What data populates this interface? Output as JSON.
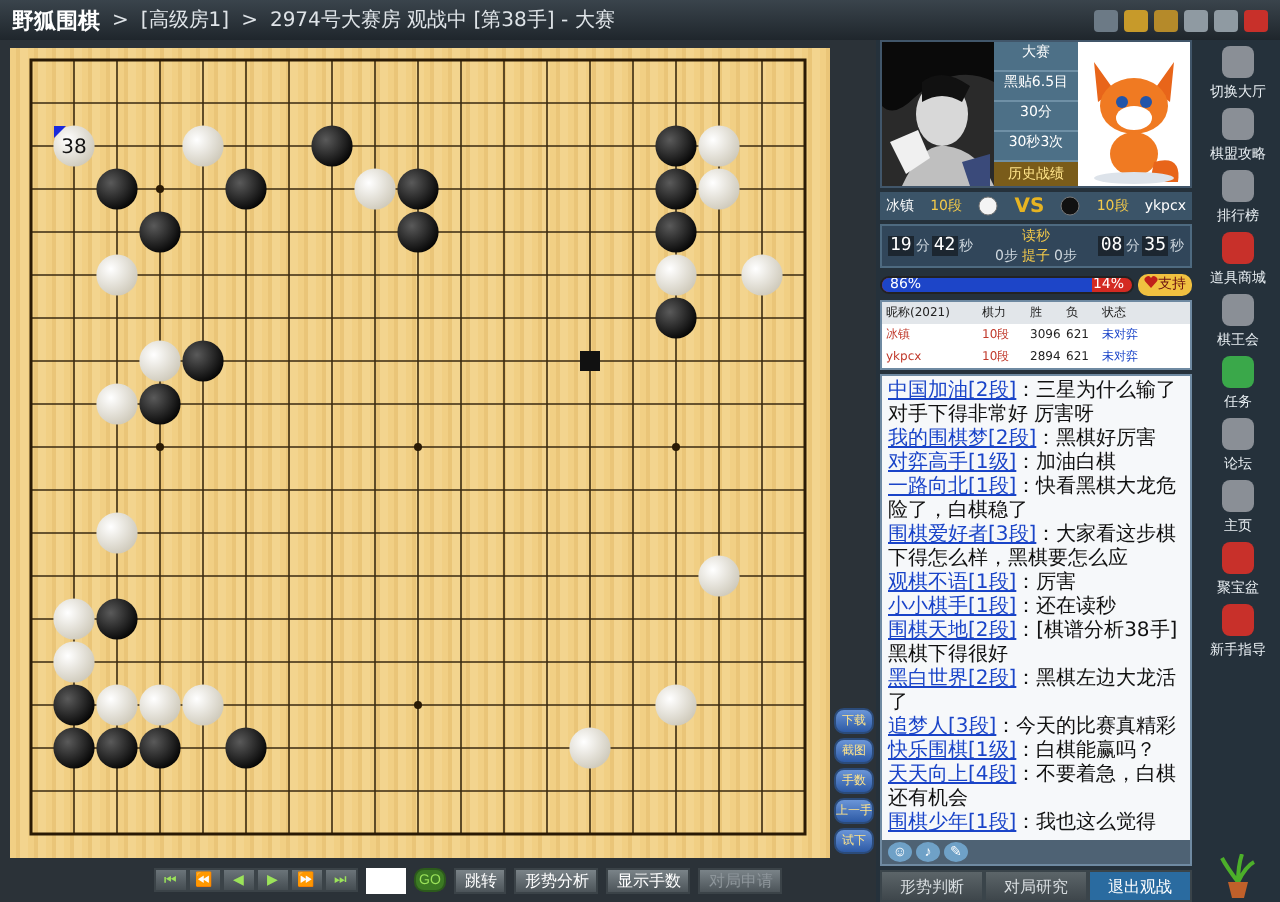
{
  "window": {
    "app_name": "野狐围棋",
    "breadcrumb": [
      {
        "separator": ">",
        "text": "[高级房1]"
      },
      {
        "separator": ">",
        "text": "2974号大赛房 观战中 [第38手] - 大赛"
      }
    ]
  },
  "board": {
    "rows": [
      {
        "points": [
          {
            "kind": "empty"
          },
          {
            "kind": "empty"
          },
          {
            "kind": "empty"
          },
          {
            "kind": "empty"
          },
          {
            "kind": "empty"
          },
          {
            "kind": "empty"
          },
          {
            "kind": "empty"
          },
          {
            "kind": "empty"
          },
          {
            "kind": "empty"
          },
          {
            "kind": "empty"
          },
          {
            "kind": "empty"
          },
          {
            "kind": "empty"
          },
          {
            "kind": "empty"
          },
          {
            "kind": "empty"
          },
          {
            "kind": "empty"
          },
          {
            "kind": "empty"
          },
          {
            "kind": "empty"
          },
          {
            "kind": "empty"
          },
          {
            "kind": "empty"
          }
        ]
      },
      {
        "points": [
          {
            "kind": "empty"
          },
          {
            "kind": "empty"
          },
          {
            "kind": "empty"
          },
          {
            "kind": "empty"
          },
          {
            "kind": "empty"
          },
          {
            "kind": "empty"
          },
          {
            "kind": "empty"
          },
          {
            "kind": "empty"
          },
          {
            "kind": "empty"
          },
          {
            "kind": "empty"
          },
          {
            "kind": "empty"
          },
          {
            "kind": "empty"
          },
          {
            "kind": "empty"
          },
          {
            "kind": "empty"
          },
          {
            "kind": "empty"
          },
          {
            "kind": "empty"
          },
          {
            "kind": "empty"
          },
          {
            "kind": "empty"
          },
          {
            "kind": "empty"
          }
        ]
      },
      {
        "points": [
          {
            "kind": "empty"
          },
          {
            "kind": "white",
            "label": "38",
            "last": true
          },
          {
            "kind": "empty"
          },
          {
            "kind": "empty"
          },
          {
            "kind": "white"
          },
          {
            "kind": "empty"
          },
          {
            "kind": "empty"
          },
          {
            "kind": "black"
          },
          {
            "kind": "empty"
          },
          {
            "kind": "empty"
          },
          {
            "kind": "empty"
          },
          {
            "kind": "empty"
          },
          {
            "kind": "empty"
          },
          {
            "kind": "empty"
          },
          {
            "kind": "empty"
          },
          {
            "kind": "black"
          },
          {
            "kind": "white"
          },
          {
            "kind": "empty"
          },
          {
            "kind": "empty"
          }
        ]
      },
      {
        "points": [
          {
            "kind": "empty"
          },
          {
            "kind": "empty"
          },
          {
            "kind": "black"
          },
          {
            "kind": "empty"
          },
          {
            "kind": "empty"
          },
          {
            "kind": "black"
          },
          {
            "kind": "empty"
          },
          {
            "kind": "empty"
          },
          {
            "kind": "white"
          },
          {
            "kind": "black"
          },
          {
            "kind": "empty"
          },
          {
            "kind": "empty"
          },
          {
            "kind": "empty"
          },
          {
            "kind": "empty"
          },
          {
            "kind": "empty"
          },
          {
            "kind": "black"
          },
          {
            "kind": "white"
          },
          {
            "kind": "empty"
          },
          {
            "kind": "empty"
          }
        ]
      },
      {
        "points": [
          {
            "kind": "empty"
          },
          {
            "kind": "empty"
          },
          {
            "kind": "empty"
          },
          {
            "kind": "black"
          },
          {
            "kind": "empty"
          },
          {
            "kind": "empty"
          },
          {
            "kind": "empty"
          },
          {
            "kind": "empty"
          },
          {
            "kind": "empty"
          },
          {
            "kind": "black"
          },
          {
            "kind": "empty"
          },
          {
            "kind": "empty"
          },
          {
            "kind": "empty"
          },
          {
            "kind": "empty"
          },
          {
            "kind": "empty"
          },
          {
            "kind": "black"
          },
          {
            "kind": "empty"
          },
          {
            "kind": "empty"
          },
          {
            "kind": "empty"
          }
        ]
      },
      {
        "points": [
          {
            "kind": "empty"
          },
          {
            "kind": "empty"
          },
          {
            "kind": "white"
          },
          {
            "kind": "empty"
          },
          {
            "kind": "empty"
          },
          {
            "kind": "empty"
          },
          {
            "kind": "empty"
          },
          {
            "kind": "empty"
          },
          {
            "kind": "empty"
          },
          {
            "kind": "empty"
          },
          {
            "kind": "empty"
          },
          {
            "kind": "empty"
          },
          {
            "kind": "empty"
          },
          {
            "kind": "empty"
          },
          {
            "kind": "empty"
          },
          {
            "kind": "white"
          },
          {
            "kind": "empty"
          },
          {
            "kind": "white"
          },
          {
            "kind": "empty"
          }
        ]
      },
      {
        "points": [
          {
            "kind": "empty"
          },
          {
            "kind": "empty"
          },
          {
            "kind": "empty"
          },
          {
            "kind": "empty"
          },
          {
            "kind": "empty"
          },
          {
            "kind": "empty"
          },
          {
            "kind": "empty"
          },
          {
            "kind": "empty"
          },
          {
            "kind": "empty"
          },
          {
            "kind": "empty"
          },
          {
            "kind": "empty"
          },
          {
            "kind": "empty"
          },
          {
            "kind": "empty"
          },
          {
            "kind": "empty"
          },
          {
            "kind": "empty"
          },
          {
            "kind": "black"
          },
          {
            "kind": "empty"
          },
          {
            "kind": "empty"
          },
          {
            "kind": "empty"
          }
        ]
      },
      {
        "points": [
          {
            "kind": "empty"
          },
          {
            "kind": "empty"
          },
          {
            "kind": "empty"
          },
          {
            "kind": "white"
          },
          {
            "kind": "black"
          },
          {
            "kind": "empty"
          },
          {
            "kind": "empty"
          },
          {
            "kind": "empty"
          },
          {
            "kind": "empty"
          },
          {
            "kind": "empty"
          },
          {
            "kind": "empty"
          },
          {
            "kind": "empty"
          },
          {
            "kind": "empty"
          },
          {
            "kind": "square"
          },
          {
            "kind": "empty"
          },
          {
            "kind": "empty"
          },
          {
            "kind": "empty"
          },
          {
            "kind": "empty"
          },
          {
            "kind": "empty"
          }
        ]
      },
      {
        "points": [
          {
            "kind": "empty"
          },
          {
            "kind": "empty"
          },
          {
            "kind": "white"
          },
          {
            "kind": "black"
          },
          {
            "kind": "empty"
          },
          {
            "kind": "empty"
          },
          {
            "kind": "empty"
          },
          {
            "kind": "empty"
          },
          {
            "kind": "empty"
          },
          {
            "kind": "empty"
          },
          {
            "kind": "empty"
          },
          {
            "kind": "empty"
          },
          {
            "kind": "empty"
          },
          {
            "kind": "empty"
          },
          {
            "kind": "empty"
          },
          {
            "kind": "empty"
          },
          {
            "kind": "empty"
          },
          {
            "kind": "empty"
          },
          {
            "kind": "empty"
          }
        ]
      },
      {
        "points": [
          {
            "kind": "empty"
          },
          {
            "kind": "empty"
          },
          {
            "kind": "empty"
          },
          {
            "kind": "empty"
          },
          {
            "kind": "empty"
          },
          {
            "kind": "empty"
          },
          {
            "kind": "empty"
          },
          {
            "kind": "empty"
          },
          {
            "kind": "empty"
          },
          {
            "kind": "empty"
          },
          {
            "kind": "empty"
          },
          {
            "kind": "empty"
          },
          {
            "kind": "empty"
          },
          {
            "kind": "empty"
          },
          {
            "kind": "empty"
          },
          {
            "kind": "empty"
          },
          {
            "kind": "empty"
          },
          {
            "kind": "empty"
          },
          {
            "kind": "empty"
          }
        ]
      },
      {
        "points": [
          {
            "kind": "empty"
          },
          {
            "kind": "empty"
          },
          {
            "kind": "empty"
          },
          {
            "kind": "empty"
          },
          {
            "kind": "empty"
          },
          {
            "kind": "empty"
          },
          {
            "kind": "empty"
          },
          {
            "kind": "empty"
          },
          {
            "kind": "empty"
          },
          {
            "kind": "empty"
          },
          {
            "kind": "empty"
          },
          {
            "kind": "empty"
          },
          {
            "kind": "empty"
          },
          {
            "kind": "empty"
          },
          {
            "kind": "empty"
          },
          {
            "kind": "empty"
          },
          {
            "kind": "empty"
          },
          {
            "kind": "empty"
          },
          {
            "kind": "empty"
          }
        ]
      },
      {
        "points": [
          {
            "kind": "empty"
          },
          {
            "kind": "empty"
          },
          {
            "kind": "white"
          },
          {
            "kind": "empty"
          },
          {
            "kind": "empty"
          },
          {
            "kind": "empty"
          },
          {
            "kind": "empty"
          },
          {
            "kind": "empty"
          },
          {
            "kind": "empty"
          },
          {
            "kind": "empty"
          },
          {
            "kind": "empty"
          },
          {
            "kind": "empty"
          },
          {
            "kind": "empty"
          },
          {
            "kind": "empty"
          },
          {
            "kind": "empty"
          },
          {
            "kind": "empty"
          },
          {
            "kind": "empty"
          },
          {
            "kind": "empty"
          },
          {
            "kind": "empty"
          }
        ]
      },
      {
        "points": [
          {
            "kind": "empty"
          },
          {
            "kind": "empty"
          },
          {
            "kind": "empty"
          },
          {
            "kind": "empty"
          },
          {
            "kind": "empty"
          },
          {
            "kind": "empty"
          },
          {
            "kind": "empty"
          },
          {
            "kind": "empty"
          },
          {
            "kind": "empty"
          },
          {
            "kind": "empty"
          },
          {
            "kind": "empty"
          },
          {
            "kind": "empty"
          },
          {
            "kind": "empty"
          },
          {
            "kind": "empty"
          },
          {
            "kind": "empty"
          },
          {
            "kind": "empty"
          },
          {
            "kind": "white"
          },
          {
            "kind": "empty"
          },
          {
            "kind": "empty"
          }
        ]
      },
      {
        "points": [
          {
            "kind": "empty"
          },
          {
            "kind": "white"
          },
          {
            "kind": "black"
          },
          {
            "kind": "empty"
          },
          {
            "kind": "empty"
          },
          {
            "kind": "empty"
          },
          {
            "kind": "empty"
          },
          {
            "kind": "empty"
          },
          {
            "kind": "empty"
          },
          {
            "kind": "empty"
          },
          {
            "kind": "empty"
          },
          {
            "kind": "empty"
          },
          {
            "kind": "empty"
          },
          {
            "kind": "empty"
          },
          {
            "kind": "empty"
          },
          {
            "kind": "empty"
          },
          {
            "kind": "empty"
          },
          {
            "kind": "empty"
          },
          {
            "kind": "empty"
          }
        ]
      },
      {
        "points": [
          {
            "kind": "empty"
          },
          {
            "kind": "white"
          },
          {
            "kind": "empty"
          },
          {
            "kind": "empty"
          },
          {
            "kind": "empty"
          },
          {
            "kind": "empty"
          },
          {
            "kind": "empty"
          },
          {
            "kind": "empty"
          },
          {
            "kind": "empty"
          },
          {
            "kind": "empty"
          },
          {
            "kind": "empty"
          },
          {
            "kind": "empty"
          },
          {
            "kind": "empty"
          },
          {
            "kind": "empty"
          },
          {
            "kind": "empty"
          },
          {
            "kind": "empty"
          },
          {
            "kind": "empty"
          },
          {
            "kind": "empty"
          },
          {
            "kind": "empty"
          }
        ]
      },
      {
        "points": [
          {
            "kind": "empty"
          },
          {
            "kind": "black"
          },
          {
            "kind": "white"
          },
          {
            "kind": "white"
          },
          {
            "kind": "white"
          },
          {
            "kind": "empty"
          },
          {
            "kind": "empty"
          },
          {
            "kind": "empty"
          },
          {
            "kind": "empty"
          },
          {
            "kind": "empty"
          },
          {
            "kind": "empty"
          },
          {
            "kind": "empty"
          },
          {
            "kind": "empty"
          },
          {
            "kind": "empty"
          },
          {
            "kind": "empty"
          },
          {
            "kind": "white"
          },
          {
            "kind": "empty"
          },
          {
            "kind": "empty"
          },
          {
            "kind": "empty"
          }
        ]
      },
      {
        "points": [
          {
            "kind": "empty"
          },
          {
            "kind": "black"
          },
          {
            "kind": "black"
          },
          {
            "kind": "black"
          },
          {
            "kind": "empty"
          },
          {
            "kind": "black"
          },
          {
            "kind": "empty"
          },
          {
            "kind": "empty"
          },
          {
            "kind": "empty"
          },
          {
            "kind": "empty"
          },
          {
            "kind": "empty"
          },
          {
            "kind": "empty"
          },
          {
            "kind": "empty"
          },
          {
            "kind": "white"
          },
          {
            "kind": "empty"
          },
          {
            "kind": "empty"
          },
          {
            "kind": "empty"
          },
          {
            "kind": "empty"
          },
          {
            "kind": "empty"
          }
        ]
      },
      {
        "points": [
          {
            "kind": "empty"
          },
          {
            "kind": "empty"
          },
          {
            "kind": "empty"
          },
          {
            "kind": "empty"
          },
          {
            "kind": "empty"
          },
          {
            "kind": "empty"
          },
          {
            "kind": "empty"
          },
          {
            "kind": "empty"
          },
          {
            "kind": "empty"
          },
          {
            "kind": "empty"
          },
          {
            "kind": "empty"
          },
          {
            "kind": "empty"
          },
          {
            "kind": "empty"
          },
          {
            "kind": "empty"
          },
          {
            "kind": "empty"
          },
          {
            "kind": "empty"
          },
          {
            "kind": "empty"
          },
          {
            "kind": "empty"
          },
          {
            "kind": "empty"
          }
        ]
      },
      {
        "points": [
          {
            "kind": "empty"
          },
          {
            "kind": "empty"
          },
          {
            "kind": "empty"
          },
          {
            "kind": "empty"
          },
          {
            "kind": "empty"
          },
          {
            "kind": "empty"
          },
          {
            "kind": "empty"
          },
          {
            "kind": "empty"
          },
          {
            "kind": "empty"
          },
          {
            "kind": "empty"
          },
          {
            "kind": "empty"
          },
          {
            "kind": "empty"
          },
          {
            "kind": "empty"
          },
          {
            "kind": "empty"
          },
          {
            "kind": "empty"
          },
          {
            "kind": "empty"
          },
          {
            "kind": "empty"
          },
          {
            "kind": "empty"
          },
          {
            "kind": "empty"
          }
        ]
      }
    ],
    "side_buttons": [
      "下载",
      "截图",
      "手数",
      "上一手",
      "试下"
    ]
  },
  "toolbar": {
    "nav": [
      "⏮",
      "⏪",
      "◀",
      "▶",
      "⏩",
      "⏭"
    ],
    "go": "GO",
    "buttons": [
      {
        "label": "跳转",
        "disabled": false
      },
      {
        "label": "形势分析",
        "disabled": false
      },
      {
        "label": "显示手数",
        "disabled": false
      },
      {
        "label": "对局申请",
        "disabled": true
      }
    ]
  },
  "match": {
    "lines": [
      "大赛",
      "黑贴6.5目",
      "30分",
      "30秒3次"
    ],
    "history": "历史战绩",
    "white": {
      "name": "冰镇",
      "rank": "10段",
      "minutes": "19",
      "unit_min": "分",
      "seconds": "42",
      "unit_sec": "秒"
    },
    "black": {
      "name": "ykpcx",
      "rank": "10段",
      "minutes": "08",
      "unit_min": "分",
      "seconds": "35",
      "unit_sec": "秒"
    },
    "vs": "VS",
    "byoyomi": "读秒",
    "captures": "提子",
    "white_captures": "0步",
    "black_captures": "0步",
    "support": {
      "white": "86%",
      "black": "14%",
      "level": 0.86,
      "button": "支持"
    }
  },
  "players": {
    "columns": [
      "昵称(2021)",
      "棋力",
      "胜",
      "负",
      "状态"
    ],
    "rows": [
      {
        "name": "冰镇",
        "rank": "10段",
        "wins": "3096",
        "losses": "621",
        "status": "未对弈"
      },
      {
        "name": "ykpcx",
        "rank": "10段",
        "wins": "2894",
        "losses": "621",
        "status": "未对弈"
      }
    ]
  },
  "chat": [
    {
      "name": "中国加油",
      "rank": "[2段]",
      "text": "：三星为什么输了"
    },
    {
      "text": "对手下得非常好 厉害呀"
    },
    {
      "name": "我的围棋梦",
      "rank": "[2段]",
      "text": "：黑棋好厉害"
    },
    {
      "name": "对弈高手",
      "rank": "[1级]",
      "text": "：加油白棋"
    },
    {
      "name": "一路向北",
      "rank": "[1段]",
      "text": "：快看黑棋大龙危险了，白棋稳了"
    },
    {
      "name": "围棋爱好者",
      "rank": "[3段]",
      "text": "：大家看这步棋下得怎么样，黑棋要怎么应"
    },
    {
      "name": "观棋不语",
      "rank": "[1段]",
      "text": "：厉害"
    },
    {
      "name": "小小棋手",
      "rank": "[1段]",
      "text": "：还在读秒"
    },
    {
      "name": "围棋天地",
      "rank": "[2段]",
      "text": "：[棋谱分析38手]黑棋下得很好"
    },
    {
      "name": "黑白世界",
      "rank": "[2段]",
      "text": "：黑棋左边大龙活了"
    },
    {
      "name": "追梦人",
      "rank": "[3段]",
      "text": "：今天的比赛真精彩"
    },
    {
      "name": "快乐围棋",
      "rank": "[1级]",
      "text": "：白棋能赢吗？"
    },
    {
      "name": "天天向上",
      "rank": "[4段]",
      "text": "：不要着急，白棋还有机会"
    },
    {
      "name": "围棋少年",
      "rank": "[1段]",
      "text": "：我也这么觉得"
    }
  ],
  "chat_tools": [
    "☺",
    "♪",
    "✎"
  ],
  "bottom_tabs": [
    {
      "label": "形势判断",
      "selected": false
    },
    {
      "label": "对局研究",
      "selected": false
    },
    {
      "label": "退出观战",
      "selected": true
    }
  ],
  "sidebar": [
    {
      "label": "切换大厅",
      "color": "#8a8f96"
    },
    {
      "label": "棋盟攻略",
      "color": "#8a8f96"
    },
    {
      "label": "排行榜",
      "color": "#8a8f96"
    },
    {
      "label": "道具商城",
      "color": "#c8302a"
    },
    {
      "label": "棋王会",
      "color": "#8a8f96"
    },
    {
      "label": "任务",
      "color": "#3aa84a"
    },
    {
      "label": "论坛",
      "color": "#8a8f96"
    },
    {
      "label": "主页",
      "color": "#8a8f96"
    },
    {
      "label": "聚宝盆",
      "color": "#c8302a"
    },
    {
      "label": "新手指导",
      "color": "#c8302a"
    }
  ]
}
